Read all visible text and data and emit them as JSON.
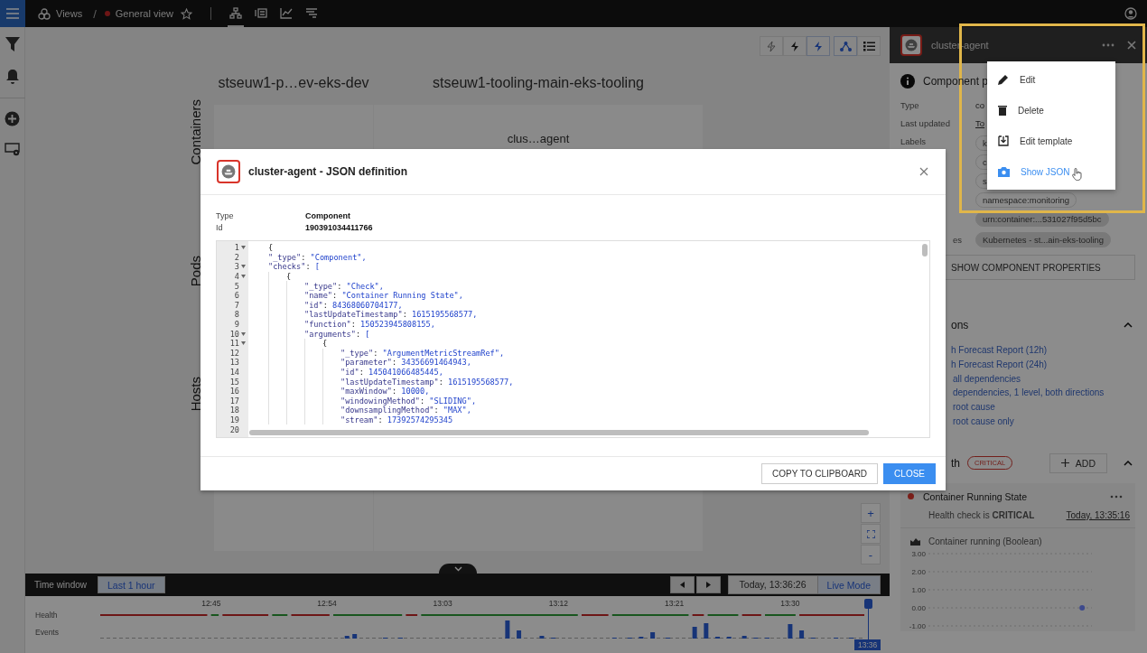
{
  "top_bar": {
    "breadcrumb": {
      "root": "Views",
      "separator": "/",
      "view": "General view",
      "starred": false
    },
    "view_tabs": [
      {
        "kind": "topology",
        "selected": true
      },
      {
        "kind": "events",
        "selected": false
      },
      {
        "kind": "metrics",
        "selected": false
      },
      {
        "kind": "traces",
        "selected": false
      }
    ]
  },
  "canvas": {
    "toolbar": [
      {
        "kind": "bolt-outline",
        "selected": false
      },
      {
        "kind": "bolt",
        "selected": false
      },
      {
        "kind": "bolt",
        "selected": true
      },
      {
        "kind": "nodes",
        "selected": true
      },
      {
        "kind": "list",
        "selected": false
      }
    ],
    "columns": [
      {
        "title": "stseuw1-p…ev-eks-dev"
      },
      {
        "title": "stseuw1-tooling-main-eks-tooling",
        "node": "clus…agent"
      }
    ],
    "layers": [
      "Containers",
      "Pods",
      "Hosts"
    ],
    "zoom_controls": {
      "zoom_in": "+",
      "zoom_out": "-"
    }
  },
  "time_window": {
    "label": "Time window",
    "range": "Last 1 hour",
    "timestamp": "Today, 13:36:26",
    "mode": "Live Mode",
    "ticks": [
      "12:45",
      "12:54",
      "13:03",
      "13:12",
      "13:21",
      "13:30"
    ],
    "rows": [
      "Health",
      "Events"
    ],
    "cursor": "13:36"
  },
  "side_panel": {
    "title": "cluster-agent",
    "section_title": "Component p",
    "properties": [
      {
        "label": "Type",
        "value": "co",
        "kind": "text"
      },
      {
        "label": "Last updated",
        "value": "To",
        "kind": "link"
      }
    ],
    "labels_label": "Labels",
    "labels": [
      "k",
      "c",
      "s",
      "namespace:monitoring",
      "urn:container:...531027f95d5bc"
    ],
    "sources_label": "es",
    "sources": [
      "Kubernetes - st...ain-eks-tooling"
    ],
    "show_properties": "SHOW COMPONENT PROPERTIES",
    "actions": {
      "title": "ons",
      "expanded": true,
      "links": [
        "h Forecast Report (12h)",
        "h Forecast Report (24h)",
        "all dependencies",
        "dependencies, 1 level, both directions",
        "root cause",
        "root cause only"
      ]
    },
    "health": {
      "title": "th",
      "state": "CRITICAL",
      "add": "ADD",
      "expanded": true,
      "checks": [
        {
          "name": "Container Running State",
          "kind": "critical",
          "status": "Health check is **CRITICAL**",
          "time": "Today, 13:35:16",
          "metric": "Container running (Boolean)",
          "chart_data": {
            "type": "scatter",
            "ylim": [
              -1,
              3
            ],
            "yticks": [
              {
                "value": 3,
                "label": "3.00"
              },
              {
                "value": 2,
                "label": "2.00"
              },
              {
                "value": 1,
                "label": "1.00"
              },
              {
                "value": 0,
                "label": "0.00"
              },
              {
                "value": -1,
                "label": "-1.00"
              }
            ],
            "grid": true,
            "categories": [
              null,
              null,
              null,
              null,
              null,
              null,
              null,
              null,
              null,
              null
            ],
            "series": [
              {
                "values": [
                  null,
                  null,
                  null,
                  null,
                  null,
                  null,
                  null,
                  null,
                  null,
                  0
                ]
              }
            ]
          }
        }
      ]
    }
  },
  "menu": {
    "items": [
      {
        "label": "Edit",
        "kind": "edit",
        "selected": false
      },
      {
        "label": "Delete",
        "kind": "delete",
        "selected": false
      },
      {
        "label": "Edit template",
        "kind": "template",
        "selected": false
      },
      {
        "label": "Show JSON",
        "kind": "camera",
        "selected": true
      }
    ]
  },
  "dialog": {
    "title": "cluster-agent - JSON definition",
    "fields": [
      {
        "label": "Type",
        "value": "Component"
      },
      {
        "label": "Id",
        "value": "190391034411766"
      }
    ],
    "code_lines": [
      {
        "number": "1",
        "foldable": true,
        "text": "{"
      },
      {
        "number": "2",
        "foldable": false,
        "text": "    \"_type\": \"Component\","
      },
      {
        "number": "3",
        "foldable": true,
        "text": "    \"checks\": ["
      },
      {
        "number": "4",
        "foldable": true,
        "text": "        {"
      },
      {
        "number": "5",
        "foldable": false,
        "text": "            \"_type\": \"Check\","
      },
      {
        "number": "6",
        "foldable": false,
        "text": "            \"name\": \"Container Running State\","
      },
      {
        "number": "7",
        "foldable": false,
        "text": "            \"id\": 84368060704177,"
      },
      {
        "number": "8",
        "foldable": false,
        "text": "            \"lastUpdateTimestamp\": 1615195568577,"
      },
      {
        "number": "9",
        "foldable": false,
        "text": "            \"function\": 150523945808155,"
      },
      {
        "number": "10",
        "foldable": true,
        "text": "            \"arguments\": ["
      },
      {
        "number": "11",
        "foldable": true,
        "text": "                {"
      },
      {
        "number": "12",
        "foldable": false,
        "text": "                    \"_type\": \"ArgumentMetricStreamRef\","
      },
      {
        "number": "13",
        "foldable": false,
        "text": "                    \"parameter\": 34356691464943,"
      },
      {
        "number": "14",
        "foldable": false,
        "text": "                    \"id\": 145041066485445,"
      },
      {
        "number": "15",
        "foldable": false,
        "text": "                    \"lastUpdateTimestamp\": 1615195568577,"
      },
      {
        "number": "16",
        "foldable": false,
        "text": "                    \"maxWindow\": 10000,"
      },
      {
        "number": "17",
        "foldable": false,
        "text": "                    \"windowingMethod\": \"SLIDING\","
      },
      {
        "number": "18",
        "foldable": false,
        "text": "                    \"downsamplingMethod\": \"MAX\","
      },
      {
        "number": "19",
        "foldable": false,
        "text": "                    \"stream\": 17392574295345"
      },
      {
        "number": "20",
        "foldable": false
      }
    ],
    "buttons": [
      {
        "label": "COPY TO CLIPBOARD",
        "kind": "secondary"
      },
      {
        "label": "CLOSE",
        "kind": "primary"
      }
    ]
  }
}
